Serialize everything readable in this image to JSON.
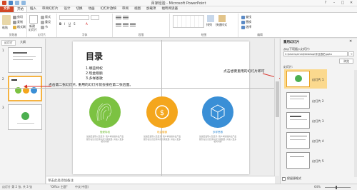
{
  "window": {
    "title": "百家经验 - Microsoft PowerPoint",
    "controls": [
      "?",
      "–",
      "□",
      "✕"
    ]
  },
  "tabs": [
    {
      "label": "文件",
      "kind": "file"
    },
    {
      "label": "开始",
      "kind": "active"
    },
    {
      "label": "插入",
      "kind": ""
    },
    {
      "label": "审阅幻灯片",
      "kind": ""
    },
    {
      "label": "设计",
      "kind": ""
    },
    {
      "label": "切换",
      "kind": ""
    },
    {
      "label": "动画",
      "kind": ""
    },
    {
      "label": "幻灯片放映",
      "kind": ""
    },
    {
      "label": "审阅",
      "kind": ""
    },
    {
      "label": "视图",
      "kind": ""
    },
    {
      "label": "加载项",
      "kind": ""
    },
    {
      "label": "福昕阅读器",
      "kind": ""
    }
  ],
  "ribbon": {
    "groups": [
      "剪贴板",
      "幻灯片",
      "字体",
      "段落",
      "绘图",
      "编辑"
    ],
    "clipboard": {
      "paste": "粘贴",
      "cut": "剪切",
      "copy": "复制",
      "format": "格式刷"
    },
    "slides": {
      "new": "新建",
      "slide": "幻灯片",
      "layout": "版式",
      "reset": "重设",
      "section": "节"
    },
    "drawing": {
      "arrange": "排列",
      "quickstyle": "快速样式"
    },
    "editing": {
      "find": "查找",
      "replace": "替换",
      "select": "选择"
    }
  },
  "left_pane": {
    "tabs": [
      "幻灯片",
      "大纲"
    ],
    "slide_numbers": [
      "1",
      "2",
      "3"
    ]
  },
  "slide": {
    "title": "目录",
    "items": [
      "1.哪些特权",
      "2.现金赠额",
      "3.多样恩歌"
    ],
    "circles": [
      {
        "label": "慢健特权",
        "color": "#7cc242",
        "desc": "加速度发现以及目录, 用户单独维护此产品服务在信息目录中的分类数量, 并进入更多相关内容"
      },
      {
        "label": "现金赠额",
        "color": "#f4a61d",
        "desc": "加速度发现以及目录, 用户单独维护此产品服务在信息目录中的分类数量, 并进入更多"
      },
      {
        "label": "多样恩歌",
        "color": "#3a8fd6",
        "desc": "加速度发现以及目录, 用户单独维护此产品服务在信息目录中的分类数量, 并进入更多相关内容"
      }
    ]
  },
  "annotations": {
    "left": "点击第二张幻灯片, 重用的幻灯片就会接在第二张后面。",
    "right": "点击想要重用的幻灯片即可"
  },
  "notes_placeholder": "单击此处添加备注",
  "right_pane": {
    "title": "重用幻灯片",
    "from_label": "从以下项插入幻灯片:",
    "path": "C:\\Users\\zmm\\Desktop\\毕业旅拍.pptx",
    "browse": "浏览",
    "slides_label": "幻灯片:",
    "slides": [
      "幻灯片 1",
      "幻灯片 2",
      "幻灯片 3",
      "幻灯片 4",
      "幻灯片 5"
    ],
    "keep_format": "保留源格式"
  },
  "status": {
    "slide_info": "幻灯片 第 2 张, 共 3 张",
    "theme": "\"Office 主题\"",
    "lang": "中文(中国)",
    "zoom": "64%"
  }
}
